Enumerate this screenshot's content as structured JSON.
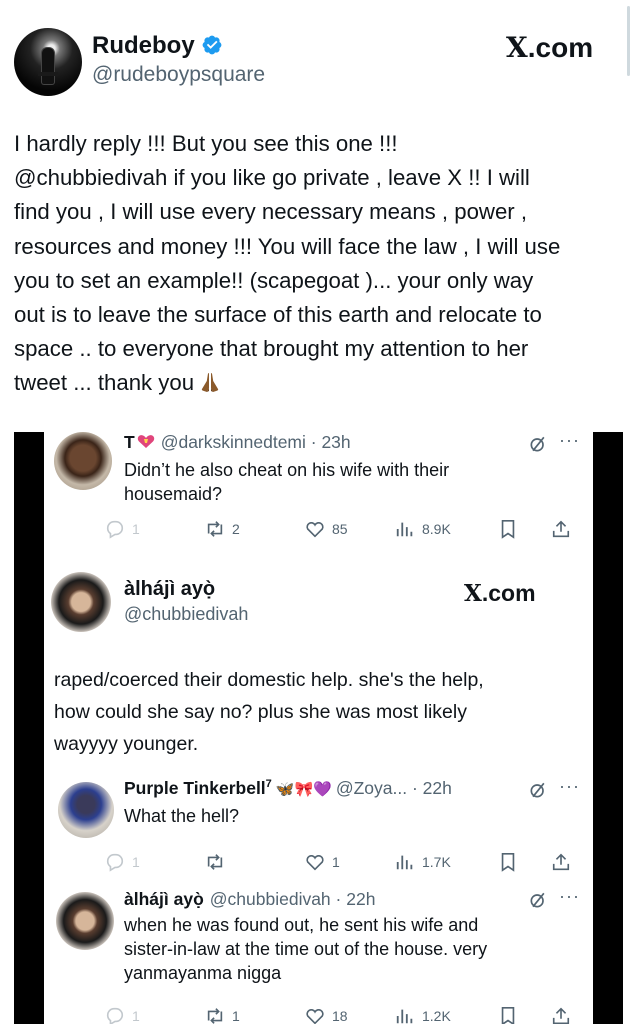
{
  "header": {
    "display_name": "Rudeboy",
    "handle": "@rudeboypsquare",
    "site_label": "X.com",
    "site_label_rest": ".com",
    "site_label_x": "X",
    "verified": true,
    "verified_color": "#1d9bf0"
  },
  "tweet": {
    "text": "I hardly reply !!! But you see this one !!!\n @chubbiedivah  if you like go private , leave X !! I will\nfind you , I will use every necessary means , power ,\nresources and money !!!  You will face the law , I will use\nyou to set an example!! (scapegoat )... your only way\nout is to leave the surface of this earth and relocate to\nspace .. to everyone that brought my attention to her\ntweet ... thank you",
    "emoji": "praying-hands"
  },
  "embedded": {
    "reply1": {
      "name": "T",
      "emoji": "heart-with-ribbon",
      "handle": "@darkskinnedtemi",
      "time": "23h",
      "text": "Didn’t he also cheat on his wife with their\nhousemaid?",
      "replies": "1",
      "reposts": "2",
      "likes": "85",
      "views": "8.9K"
    },
    "quoted": {
      "name": "àlhájì ayọ̀",
      "handle": "@chubbiedivah",
      "site_label_x": "X",
      "site_label_rest": ".com",
      "text": "raped/coerced their domestic help. she's the help,\nhow could she say no? plus she was most likely\nwayyyy younger."
    },
    "reply2": {
      "name": "Purple Tinkerbell",
      "superscript": "7",
      "emojis": "🦋🎀💜",
      "handle": "@Zoya...",
      "time": "22h",
      "text": "What the hell?",
      "replies": "1",
      "reposts": "",
      "likes": "1",
      "views": "1.7K"
    },
    "reply3": {
      "name": "àlhájì ayọ̀",
      "handle": "@chubbiedivah",
      "time": "22h",
      "text": "when he was found out, he sent his wife and\nsister-in-law at the time out of the house.  very\nyanmayanma nigga",
      "replies": "1",
      "reposts": "1",
      "likes": "18",
      "views": "1.2K"
    }
  },
  "colors": {
    "text": "#0f1419",
    "muted": "#536471",
    "verified": "#1d9bf0"
  }
}
